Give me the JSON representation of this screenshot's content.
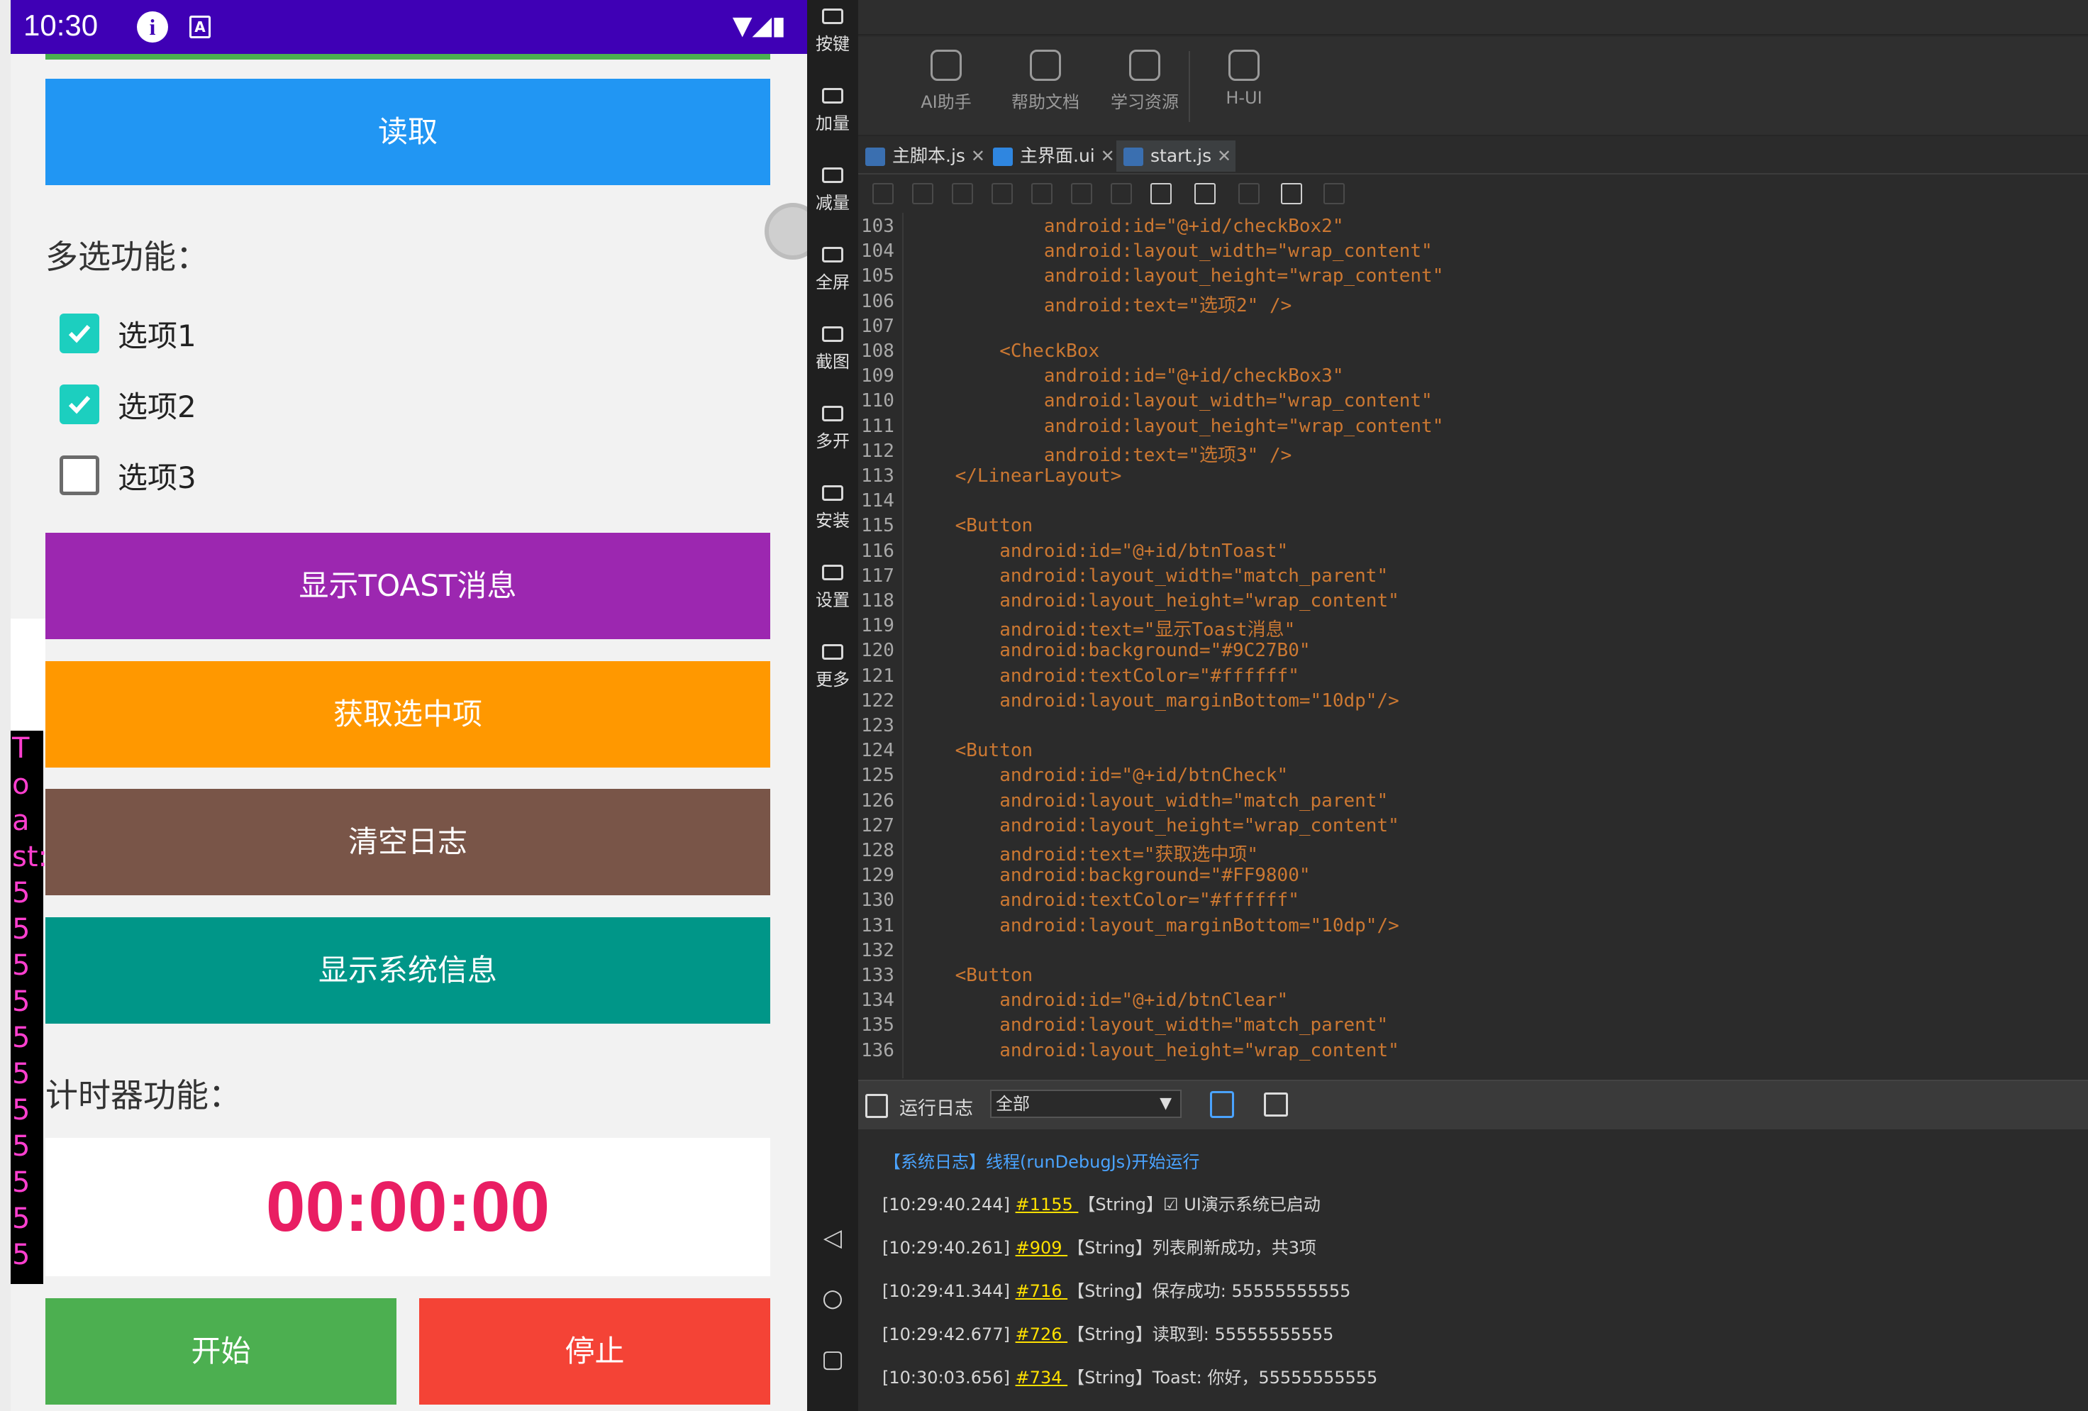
{
  "status_bar": {
    "time": "10:30",
    "info_glyph": "i",
    "a_glyph": "A"
  },
  "phone": {
    "read_button": "读取",
    "multi_select_label": "多选功能：",
    "checkboxes": [
      {
        "label": "选项1",
        "checked": true
      },
      {
        "label": "选项2",
        "checked": true
      },
      {
        "label": "选项3",
        "checked": false
      }
    ],
    "btn_toast": "显示TOAST消息",
    "btn_get_selected": "获取选中项",
    "btn_clear_log": "清空日志",
    "btn_sys_info": "显示系统信息",
    "timer_label": "计时器功能：",
    "timer_value": "00:00:00",
    "btn_start": "开始",
    "btn_stop": "停止",
    "toast_strip": "T\no\na\nst:\n5\n5\n5\n5\n5\n5\n5\n5\n5\n5\n5",
    "colors": {
      "read": "#2196F3",
      "toast": "#9C27B0",
      "get": "#FF9800",
      "clear": "#795548",
      "sys": "#009688",
      "start": "#4CAF50",
      "stop": "#F44336",
      "timer": "#E91E63",
      "status": "#3F00B5"
    }
  },
  "sidebar": {
    "items": [
      "按键",
      "加量",
      "减量",
      "全屏",
      "截图",
      "多开",
      "安装",
      "设置",
      "更多"
    ],
    "nav_icons": [
      "back-icon",
      "home-icon",
      "recents-icon"
    ]
  },
  "ide": {
    "tools": [
      "AI助手",
      "帮助文档",
      "学习资源",
      "H-UI"
    ],
    "tabs": [
      {
        "name": "主脚本.js",
        "icon": "js-file-icon"
      },
      {
        "name": "主界面.ui",
        "icon": "ui-file-icon"
      },
      {
        "name": "start.js",
        "icon": "js-file-icon"
      }
    ],
    "code_lines": [
      {
        "no": "103",
        "text": "            android:id=\"@+id/checkBox2\""
      },
      {
        "no": "104",
        "text": "            android:layout_width=\"wrap_content\""
      },
      {
        "no": "105",
        "text": "            android:layout_height=\"wrap_content\""
      },
      {
        "no": "106",
        "text": "            android:text=\"选项2\" />"
      },
      {
        "no": "107",
        "text": ""
      },
      {
        "no": "108",
        "text": "        <CheckBox"
      },
      {
        "no": "109",
        "text": "            android:id=\"@+id/checkBox3\""
      },
      {
        "no": "110",
        "text": "            android:layout_width=\"wrap_content\""
      },
      {
        "no": "111",
        "text": "            android:layout_height=\"wrap_content\""
      },
      {
        "no": "112",
        "text": "            android:text=\"选项3\" />"
      },
      {
        "no": "113",
        "text": "    </LinearLayout>"
      },
      {
        "no": "114",
        "text": ""
      },
      {
        "no": "115",
        "text": "    <Button"
      },
      {
        "no": "116",
        "text": "        android:id=\"@+id/btnToast\""
      },
      {
        "no": "117",
        "text": "        android:layout_width=\"match_parent\""
      },
      {
        "no": "118",
        "text": "        android:layout_height=\"wrap_content\""
      },
      {
        "no": "119",
        "text": "        android:text=\"显示Toast消息\""
      },
      {
        "no": "120",
        "text": "        android:background=\"#9C27B0\""
      },
      {
        "no": "121",
        "text": "        android:textColor=\"#ffffff\""
      },
      {
        "no": "122",
        "text": "        android:layout_marginBottom=\"10dp\"/>"
      },
      {
        "no": "123",
        "text": ""
      },
      {
        "no": "124",
        "text": "    <Button"
      },
      {
        "no": "125",
        "text": "        android:id=\"@+id/btnCheck\""
      },
      {
        "no": "126",
        "text": "        android:layout_width=\"match_parent\""
      },
      {
        "no": "127",
        "text": "        android:layout_height=\"wrap_content\""
      },
      {
        "no": "128",
        "text": "        android:text=\"获取选中项\""
      },
      {
        "no": "129",
        "text": "        android:background=\"#FF9800\""
      },
      {
        "no": "130",
        "text": "        android:textColor=\"#ffffff\""
      },
      {
        "no": "131",
        "text": "        android:layout_marginBottom=\"10dp\"/>"
      },
      {
        "no": "132",
        "text": ""
      },
      {
        "no": "133",
        "text": "    <Button"
      },
      {
        "no": "134",
        "text": "        android:id=\"@+id/btnClear\""
      },
      {
        "no": "135",
        "text": "        android:layout_width=\"match_parent\""
      },
      {
        "no": "136",
        "text": "        android:layout_height=\"wrap_content\""
      }
    ],
    "log": {
      "title": "运行日志",
      "filter": "全部",
      "system_line": "【系统日志】线程(runDebugJs)开始运行",
      "entries": [
        {
          "time": "[10:29:40.244]",
          "id": "#1155",
          "text": "【String】☑ UI演示系统已启动"
        },
        {
          "time": "[10:29:40.261]",
          "id": "#909",
          "text": "【String】列表刷新成功，共3项"
        },
        {
          "time": "[10:29:41.344]",
          "id": "#716",
          "text": "【String】保存成功: 55555555555"
        },
        {
          "time": "[10:29:42.677]",
          "id": "#726",
          "text": "【String】读取到: 55555555555"
        },
        {
          "time": "[10:30:03.656]",
          "id": "#734",
          "text": "【String】Toast: 你好，55555555555"
        }
      ]
    }
  }
}
